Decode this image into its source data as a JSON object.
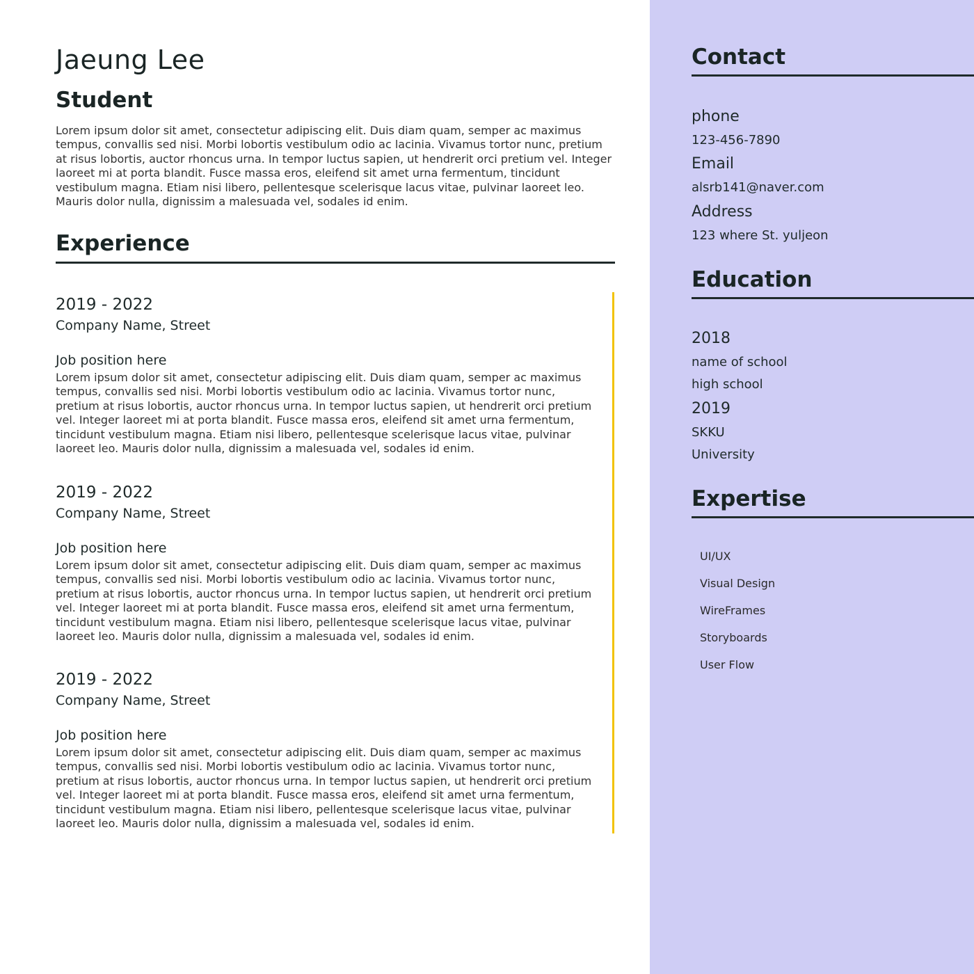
{
  "profile": {
    "name": "Jaeung Lee",
    "role": "Student",
    "intro": "Lorem ipsum dolor sit amet, consectetur adipiscing elit. Duis diam quam, semper ac maximus tempus, convallis sed nisi. Morbi lobortis vestibulum odio ac lacinia. Vivamus tortor nunc, pretium at risus lobortis, auctor rhoncus urna. In tempor luctus sapien, ut hendrerit orci pretium vel. Integer laoreet mi at porta blandit. Fusce massa eros, eleifend sit amet urna fermentum, tincidunt vestibulum magna. Etiam nisi libero, pellentesque scelerisque lacus vitae, pulvinar laoreet leo. Mauris dolor nulla, dignissim a malesuada vel, sodales id enim."
  },
  "experience": {
    "heading": "Experience",
    "jobs": [
      {
        "years": "2019 - 2022",
        "company": "Company Name, Street",
        "title": "Job position here",
        "description": "Lorem ipsum dolor sit amet, consectetur adipiscing elit. Duis diam quam, semper ac maximus tempus, convallis sed nisi. Morbi lobortis vestibulum odio ac lacinia. Vivamus tortor nunc, pretium at risus lobortis, auctor rhoncus urna. In tempor luctus sapien, ut hendrerit orci pretium vel. Integer laoreet mi at porta blandit. Fusce massa eros, eleifend sit amet urna fermentum, tincidunt vestibulum magna. Etiam nisi libero, pellentesque scelerisque lacus vitae, pulvinar laoreet leo. Mauris dolor nulla, dignissim a malesuada vel, sodales id enim."
      },
      {
        "years": "2019 - 2022",
        "company": "Company Name, Street",
        "title": "Job position here",
        "description": "Lorem ipsum dolor sit amet, consectetur adipiscing elit. Duis diam quam, semper ac maximus tempus, convallis sed nisi. Morbi lobortis vestibulum odio ac lacinia. Vivamus tortor nunc, pretium at risus lobortis, auctor rhoncus urna. In tempor luctus sapien, ut hendrerit orci pretium vel. Integer laoreet mi at porta blandit. Fusce massa eros, eleifend sit amet urna fermentum, tincidunt vestibulum magna. Etiam nisi libero, pellentesque scelerisque lacus vitae, pulvinar laoreet leo. Mauris dolor nulla, dignissim a malesuada vel, sodales id enim."
      },
      {
        "years": "2019 - 2022",
        "company": "Company Name, Street",
        "title": "Job position here",
        "description": "Lorem ipsum dolor sit amet, consectetur adipiscing elit. Duis diam quam, semper ac maximus tempus, convallis sed nisi. Morbi lobortis vestibulum odio ac lacinia. Vivamus tortor nunc, pretium at risus lobortis, auctor rhoncus urna. In tempor luctus sapien, ut hendrerit orci pretium vel. Integer laoreet mi at porta blandit. Fusce massa eros, eleifend sit amet urna fermentum, tincidunt vestibulum magna. Etiam nisi libero, pellentesque scelerisque lacus vitae, pulvinar laoreet leo. Mauris dolor nulla, dignissim a malesuada vel, sodales id enim."
      }
    ]
  },
  "contact": {
    "heading": "Contact",
    "phone_label": "phone",
    "phone": "123-456-7890",
    "email_label": "Email",
    "email": "alsrb141@naver.com",
    "address_label": "Address",
    "address": "123 where St. yuljeon"
  },
  "education": {
    "heading": "Education",
    "entries": [
      {
        "year": "2018",
        "school": "name of school",
        "level": "high school"
      },
      {
        "year": "2019",
        "school": "SKKU",
        "level": "University"
      }
    ]
  },
  "expertise": {
    "heading": "Expertise",
    "skills": [
      "UI/UX",
      "Visual Design",
      "WireFrames",
      "Storyboards",
      "User Flow"
    ]
  },
  "colors": {
    "sidebar_bg": "#cfcdf5",
    "timeline_accent": "#f2c200",
    "text": "#1f2a2a"
  }
}
